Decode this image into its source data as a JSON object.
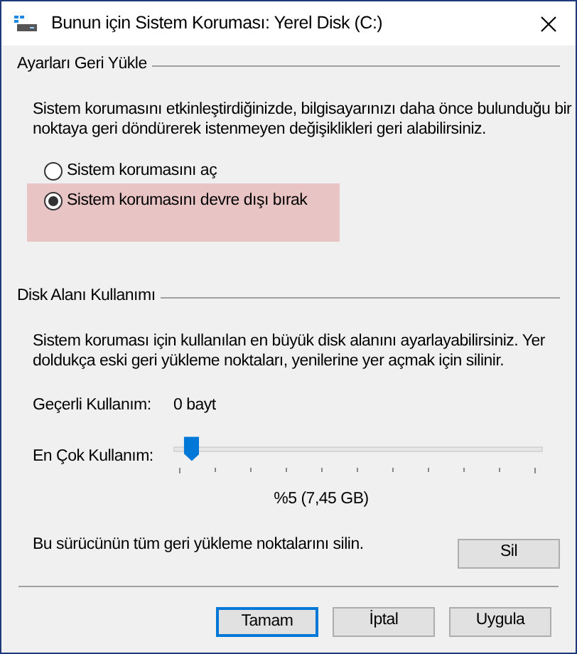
{
  "window": {
    "title": "Bunun için Sistem Koruması: Yerel Disk (C:)"
  },
  "restore_settings": {
    "title": "Ayarları Geri Yükle",
    "description": "Sistem korumasını etkinleştirdiğinizde, bilgisayarınızı daha önce bulunduğu bir noktaya geri döndürerek istenmeyen değişiklikleri geri alabilirsiniz.",
    "options": [
      {
        "label": "Sistem korumasını aç",
        "selected": false,
        "highlighted": false
      },
      {
        "label": "Sistem korumasını devre dışı bırak",
        "selected": true,
        "highlighted": true
      }
    ]
  },
  "disk_usage": {
    "title": "Disk Alanı Kullanımı",
    "description": "Sistem koruması için kullanılan en büyük disk alanını ayarlayabilirsiniz. Yer doldukça eski geri yükleme noktaları, yenilerine yer açmak için silinir.",
    "current_label": "Geçerli Kullanım:",
    "current_value": "0 bayt",
    "max_label": "En Çok Kullanım:",
    "max_usage": {
      "level": 0.03
    },
    "max_reading": "%5 (7,45 GB)",
    "delete_text": "Bu sürücünün tüm geri yükleme noktalarını silin.",
    "delete_button": "Sil"
  },
  "buttons": [
    {
      "label": "Tamam",
      "default": true
    },
    {
      "label": "İptal",
      "default": false
    },
    {
      "label": "Uygula",
      "default": false
    }
  ]
}
